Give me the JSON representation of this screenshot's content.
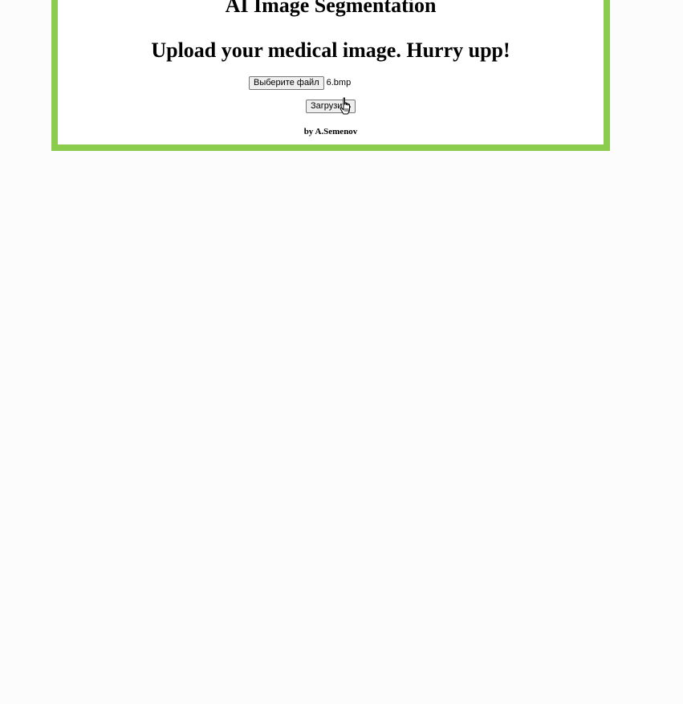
{
  "page": {
    "title": "AI Image Segmentation",
    "subtitle": "Upload your medical image. Hurry upp!",
    "byline": "by A.Semenov"
  },
  "upload_form": {
    "choose_file_label": "Выберите файл",
    "selected_file": "6.bmp",
    "submit_label": "Загрузить"
  },
  "colors": {
    "frame_border": "#8bcc4d",
    "background": "#fcfcfc"
  },
  "icons": {
    "cursor": "hand-pointer-icon"
  }
}
